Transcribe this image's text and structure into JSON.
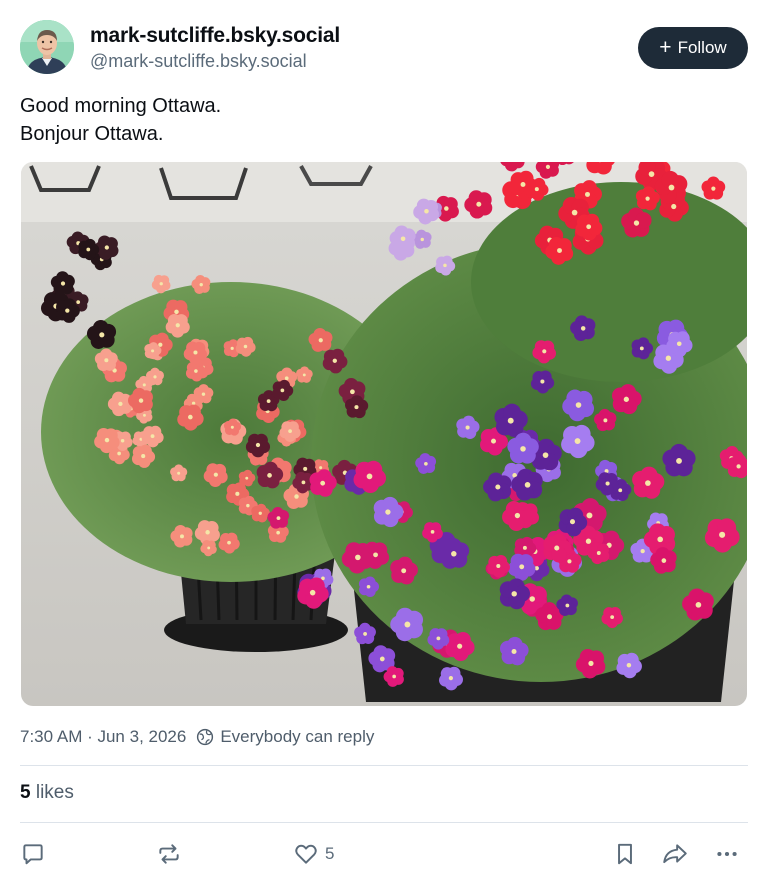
{
  "author": {
    "display_name": "mark-sutcliffe.bsky.social",
    "handle": "@mark-sutcliffe.bsky.social",
    "avatar_icon": "profile-photo"
  },
  "follow_button": {
    "label": "Follow",
    "icon": "plus-icon"
  },
  "post": {
    "lines": [
      "Good morning Ottawa.",
      "Bonjour Ottawa."
    ],
    "image_icon": "flower-planter-photo"
  },
  "meta": {
    "timestamp": "7:30 AM · Jun 3, 2026",
    "reply_setting": "Everybody can reply",
    "reply_icon": "globe-icon"
  },
  "stats": {
    "likes_count": "5",
    "likes_label": "likes"
  },
  "actions": {
    "reply_icon": "reply-icon",
    "repost_icon": "repost-icon",
    "like_icon": "heart-icon",
    "like_count": "5",
    "bookmark_icon": "bookmark-icon",
    "share_icon": "share-icon",
    "more_icon": "more-icon"
  },
  "colors": {
    "follow_bg": "#1e2b38",
    "muted_text": "#4f5d6b",
    "divider": "#dde3ea",
    "avatar_bg": "#8fd6b5"
  }
}
